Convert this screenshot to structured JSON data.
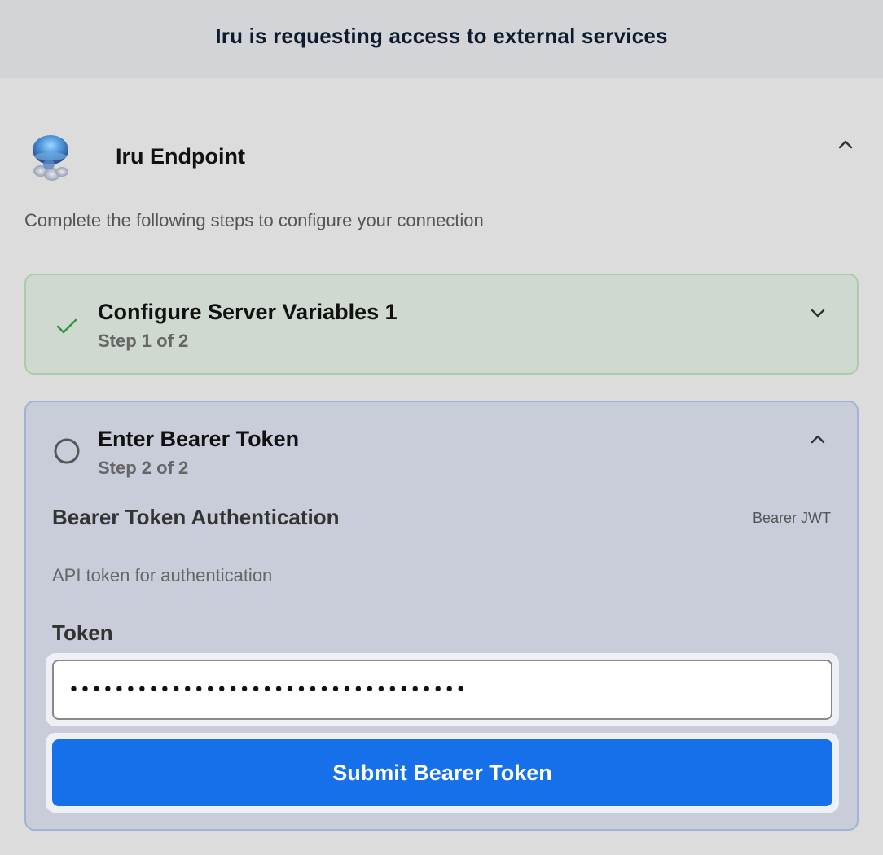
{
  "header": {
    "title": "Iru is requesting access to external services"
  },
  "service": {
    "name": "Iru Endpoint",
    "avatar_icon": "jellyfish-icon"
  },
  "subtitle": "Complete the following steps to configure your connection",
  "steps": [
    {
      "title": "Configure Server Variables 1",
      "subtitle": "Step 1 of 2",
      "status": "complete",
      "icon": "check-icon"
    },
    {
      "title": "Enter Bearer Token",
      "subtitle": "Step 2 of 2",
      "status": "pending",
      "icon": "circle-icon"
    }
  ],
  "auth": {
    "title": "Bearer Token Authentication",
    "type": "Bearer JWT",
    "description": "API token for authentication",
    "token_label": "Token",
    "token_value": "•••••••••••••••••••••••••••••••••••",
    "submit_label": "Submit Bearer Token"
  },
  "colors": {
    "accent": "#1670ea",
    "success": "#2e9b3e",
    "header_bg": "#d3d4d8",
    "page_bg": "#dcdcdc"
  }
}
